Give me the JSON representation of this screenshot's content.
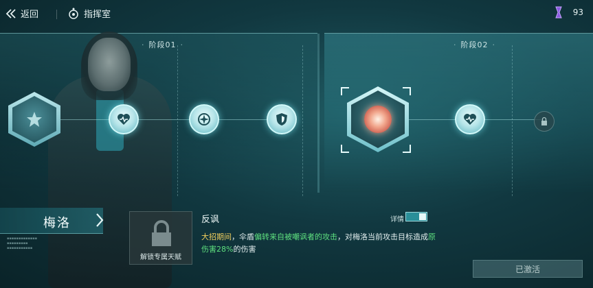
{
  "topbar": {
    "back_label": "返回",
    "room_label": "指挥室",
    "currency_value": "93"
  },
  "stages": [
    {
      "title": "阶段01"
    },
    {
      "title": "阶段02"
    }
  ],
  "character": {
    "name": "梅洛"
  },
  "unlock_card": {
    "label": "解锁专属天赋"
  },
  "skill": {
    "title": "反讽",
    "detail_label": "详情",
    "desc_part1": "大招期间",
    "desc_part2": "，伞盾",
    "desc_part3": "偏转来自被嘲讽者的攻击",
    "desc_part4": "，对梅洛当前攻击目标造成",
    "desc_part5": "原伤害28%",
    "desc_part6": "的伤害"
  },
  "activate_button": {
    "label": "已激活"
  },
  "icons": {
    "back": "double-chevron-left-icon",
    "room": "target-icon",
    "currency": "crystal-icon",
    "heart": "heart-pulse-icon",
    "compass": "compass-icon",
    "shield": "shield-icon",
    "lock": "lock-icon"
  },
  "colors": {
    "accent": "#2a8f99",
    "highlight_gold": "#f3cf5d",
    "highlight_green": "#5ee07f"
  }
}
